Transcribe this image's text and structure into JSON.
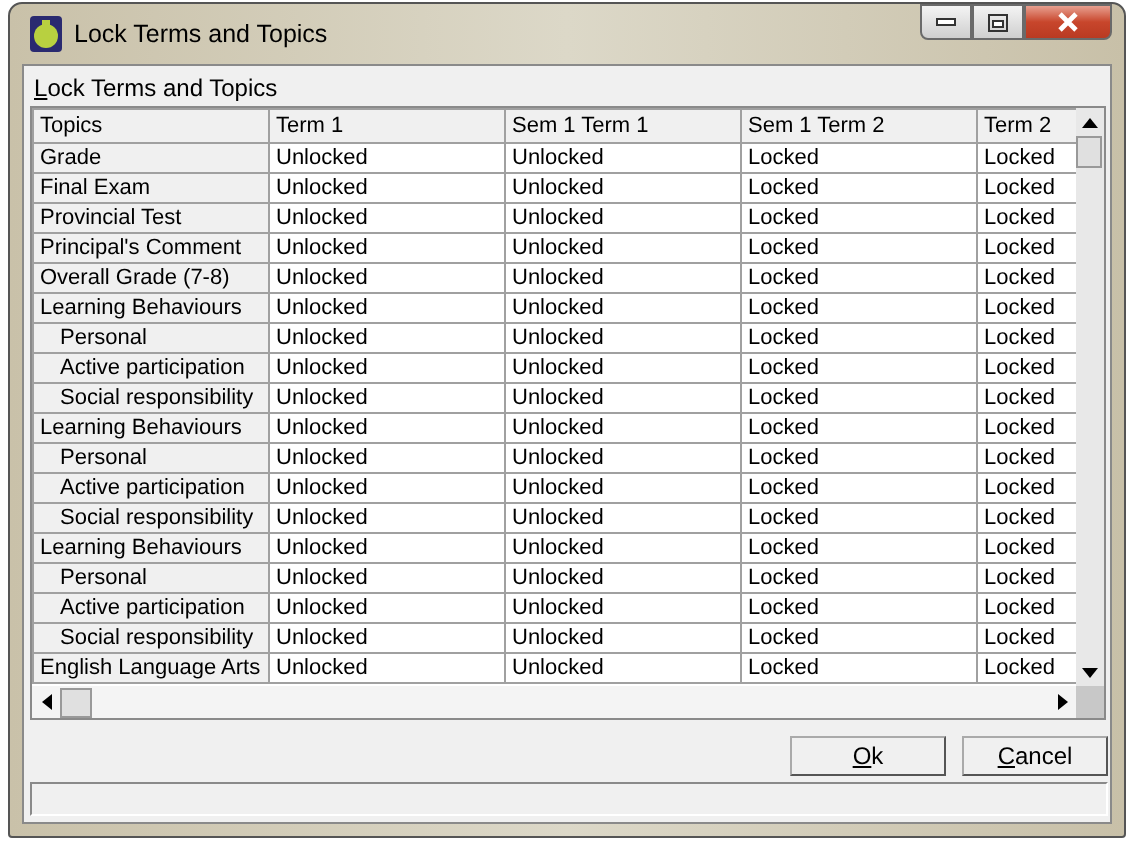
{
  "window": {
    "title": "Lock Terms and Topics"
  },
  "group_label": {
    "text": "Lock Terms and Topics",
    "mnemonic_underlined": true
  },
  "table": {
    "columns": [
      "Topics",
      "Term 1",
      "Sem 1 Term 1",
      "Sem 1 Term 2",
      "Term 2"
    ],
    "rows": [
      {
        "cells": [
          "Grade",
          "Unlocked",
          "Unlocked",
          "Locked",
          "Locked"
        ]
      },
      {
        "cells": [
          "Final Exam",
          "Unlocked",
          "Unlocked",
          "Locked",
          "Locked"
        ]
      },
      {
        "cells": [
          "Provincial Test",
          "Unlocked",
          "Unlocked",
          "Locked",
          "Locked"
        ]
      },
      {
        "cells": [
          "Principal's Comment",
          "Unlocked",
          "Unlocked",
          "Locked",
          "Locked"
        ]
      },
      {
        "cells": [
          "Overall Grade (7-8)",
          "Unlocked",
          "Unlocked",
          "Locked",
          "Locked"
        ]
      },
      {
        "cells": [
          "Learning Behaviours",
          "Unlocked",
          "Unlocked",
          "Locked",
          "Locked"
        ],
        "children": [
          {
            "cells": [
              "Personal",
              "Unlocked",
              "Unlocked",
              "Locked",
              "Locked"
            ]
          },
          {
            "cells": [
              "Active participation",
              "Unlocked",
              "Unlocked",
              "Locked",
              "Locked"
            ]
          },
          {
            "cells": [
              "Social responsibility",
              "Unlocked",
              "Unlocked",
              "Locked",
              "Locked"
            ]
          }
        ]
      },
      {
        "cells": [
          "Learning Behaviours",
          "Unlocked",
          "Unlocked",
          "Locked",
          "Locked"
        ],
        "children": [
          {
            "cells": [
              "Personal",
              "Unlocked",
              "Unlocked",
              "Locked",
              "Locked"
            ]
          },
          {
            "cells": [
              "Active participation",
              "Unlocked",
              "Unlocked",
              "Locked",
              "Locked"
            ]
          },
          {
            "cells": [
              "Social responsibility",
              "Unlocked",
              "Unlocked",
              "Locked",
              "Locked"
            ]
          }
        ]
      },
      {
        "cells": [
          "Learning Behaviours",
          "Unlocked",
          "Unlocked",
          "Locked",
          "Locked"
        ],
        "children": [
          {
            "cells": [
              "Personal",
              "Unlocked",
              "Unlocked",
              "Locked",
              "Locked"
            ]
          },
          {
            "cells": [
              "Active participation",
              "Unlocked",
              "Unlocked",
              "Locked",
              "Locked"
            ]
          },
          {
            "cells": [
              "Social responsibility",
              "Unlocked",
              "Unlocked",
              "Locked",
              "Locked"
            ]
          }
        ]
      },
      {
        "cells": [
          "English Language Arts",
          "Unlocked",
          "Unlocked",
          "Locked",
          "Locked"
        ]
      }
    ]
  },
  "buttons": [
    {
      "label": "Ok",
      "mnemonic_underlined": true
    },
    {
      "label": "Cancel",
      "mnemonic_underlined": true
    }
  ]
}
